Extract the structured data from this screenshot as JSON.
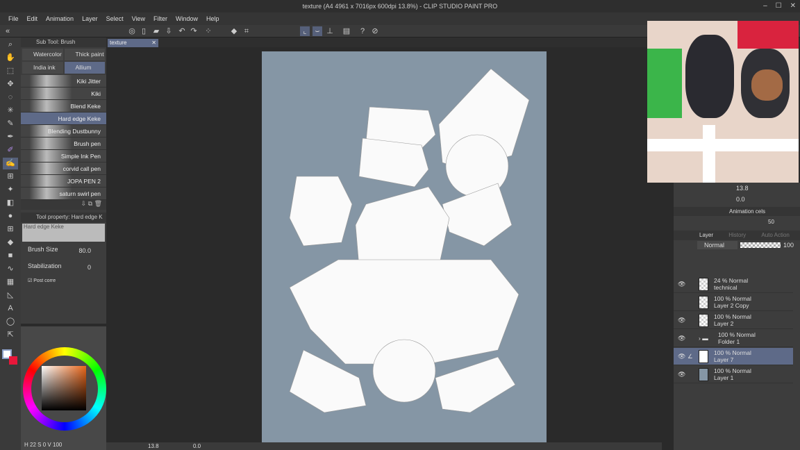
{
  "window": {
    "title": "texture (A4 4961 x 7016px 600dpi 13.8%) - CLIP STUDIO PAINT PRO"
  },
  "menu": [
    "File",
    "Edit",
    "Animation",
    "Layer",
    "Select",
    "View",
    "Filter",
    "Window",
    "Help"
  ],
  "subtool": {
    "title": "Sub Tool: Brush",
    "groups": [
      "Watercolor",
      "Thick paint",
      "India ink",
      "Allium"
    ],
    "brushes": [
      "Kiki Jitter",
      "Kiki",
      "Blend Keke",
      "Hard edge Keke",
      "Blending Dustbunny",
      "Brush pen",
      "Simple Ink Pen",
      "corvid call pen",
      "JOPA PEN 2",
      "saturn swirl pen"
    ]
  },
  "tool_property": {
    "title": "Tool property: Hard edge K",
    "preset": "Hard edge Keke",
    "brush_size_label": "Brush Size",
    "brush_size": "80.0",
    "stabilization_label": "Stabilization",
    "stabilization": "0",
    "post_correction_label": "Post corre"
  },
  "canvas": {
    "tab": "texture"
  },
  "statusbar": {
    "zoom": "13.8",
    "rotation": "0.0"
  },
  "color": {
    "h_label": "H",
    "h": "22",
    "s_label": "S",
    "s": "0",
    "v_label": "V",
    "v": "100",
    "main": "#ffffff",
    "sub": "#e8173a"
  },
  "navigator": {
    "zoom": "13.8",
    "rotation": "0.0"
  },
  "animation": {
    "tab": "Animation cels",
    "onion": "50"
  },
  "layer_panel": {
    "tabs": [
      "Layer",
      "History",
      "Auto Action"
    ],
    "blend": "Normal",
    "opacity": "100",
    "layers": [
      {
        "mode": "24 % Normal",
        "name": "technical",
        "visible": true
      },
      {
        "mode": "100 % Normal",
        "name": "Layer 2 Copy",
        "visible": false
      },
      {
        "mode": "100 % Normal",
        "name": "Layer 2",
        "visible": true
      },
      {
        "mode": "100 % Normal",
        "name": "Folder 1",
        "visible": true
      },
      {
        "mode": "100 % Normal",
        "name": "Layer 7",
        "visible": true
      },
      {
        "mode": "100 % Normal",
        "name": "Layer 1",
        "visible": true
      }
    ]
  }
}
